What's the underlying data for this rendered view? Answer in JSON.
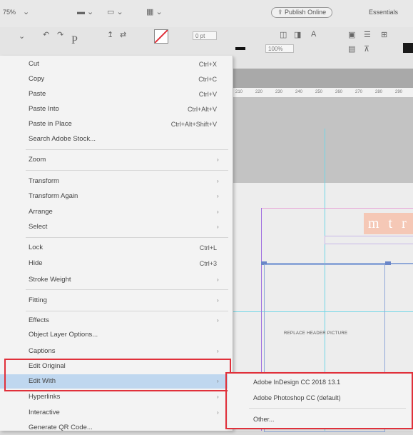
{
  "toolbar": {
    "zoom": "75%",
    "publish_online": "Publish Online",
    "workspace": "Essentials",
    "font_size": "0 pt",
    "percent": "100%"
  },
  "ruler": {
    "ticks": [
      "210",
      "220",
      "230",
      "240",
      "250",
      "260",
      "270",
      "280",
      "290"
    ]
  },
  "document": {
    "header_text": "m t r",
    "placeholder_label": "REPLACE HEADER PICTURE"
  },
  "context_menu": {
    "items": [
      {
        "label": "Cut",
        "shortcut": "Ctrl+X"
      },
      {
        "label": "Copy",
        "shortcut": "Ctrl+C"
      },
      {
        "label": "Paste",
        "shortcut": "Ctrl+V"
      },
      {
        "label": "Paste Into",
        "shortcut": "Ctrl+Alt+V"
      },
      {
        "label": "Paste in Place",
        "shortcut": "Ctrl+Alt+Shift+V"
      },
      {
        "label": "Search Adobe Stock..."
      },
      {
        "label": "Zoom"
      },
      {
        "label": "Transform"
      },
      {
        "label": "Transform Again"
      },
      {
        "label": "Arrange"
      },
      {
        "label": "Select"
      },
      {
        "label": "Lock",
        "shortcut": "Ctrl+L"
      },
      {
        "label": "Hide",
        "shortcut": "Ctrl+3"
      },
      {
        "label": "Stroke Weight"
      },
      {
        "label": "Fitting"
      },
      {
        "label": "Effects"
      },
      {
        "label": "Object Layer Options..."
      },
      {
        "label": "Captions"
      },
      {
        "label": "Edit Original"
      },
      {
        "label": "Edit With"
      },
      {
        "label": "Hyperlinks"
      },
      {
        "label": "Interactive"
      },
      {
        "label": "Generate QR Code..."
      }
    ]
  },
  "submenu": {
    "items": [
      {
        "label": "Adobe InDesign CC 2018 13.1"
      },
      {
        "label": "Adobe Photoshop CC (default)"
      },
      {
        "label": "Other..."
      }
    ]
  },
  "highlight_color": "#bfd7ef",
  "callout_color": "#e0303a"
}
